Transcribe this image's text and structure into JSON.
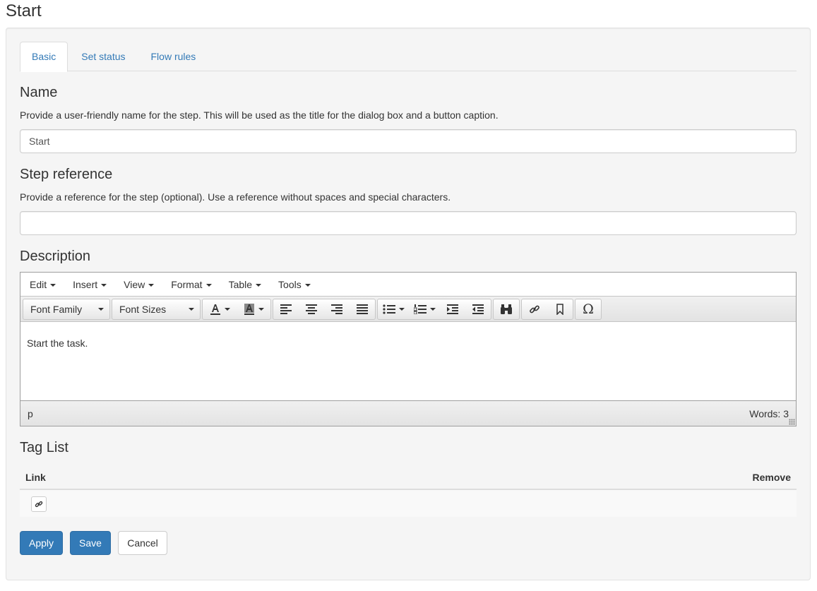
{
  "page_title": "Start",
  "tabs": [
    {
      "label": "Basic",
      "active": true
    },
    {
      "label": "Set status",
      "active": false
    },
    {
      "label": "Flow rules",
      "active": false
    }
  ],
  "name_section": {
    "title": "Name",
    "help": "Provide a user-friendly name for the step. This will be used as the title for the dialog box and a button caption.",
    "value": "Start"
  },
  "reference_section": {
    "title": "Step reference",
    "help": "Provide a reference for the step (optional). Use a reference without spaces and special characters.",
    "value": ""
  },
  "description_section": {
    "title": "Description",
    "menu": [
      "Edit",
      "Insert",
      "View",
      "Format",
      "Table",
      "Tools"
    ],
    "font_family_label": "Font Family",
    "font_sizes_label": "Font Sizes",
    "content": "Start the task.",
    "status_path": "p",
    "word_count": "Words: 3"
  },
  "tag_list": {
    "title": "Tag List",
    "col_link": "Link",
    "col_remove": "Remove"
  },
  "buttons": {
    "apply": "Apply",
    "save": "Save",
    "cancel": "Cancel"
  },
  "colors": {
    "primary": "#337ab7",
    "link": "#337ab7"
  }
}
